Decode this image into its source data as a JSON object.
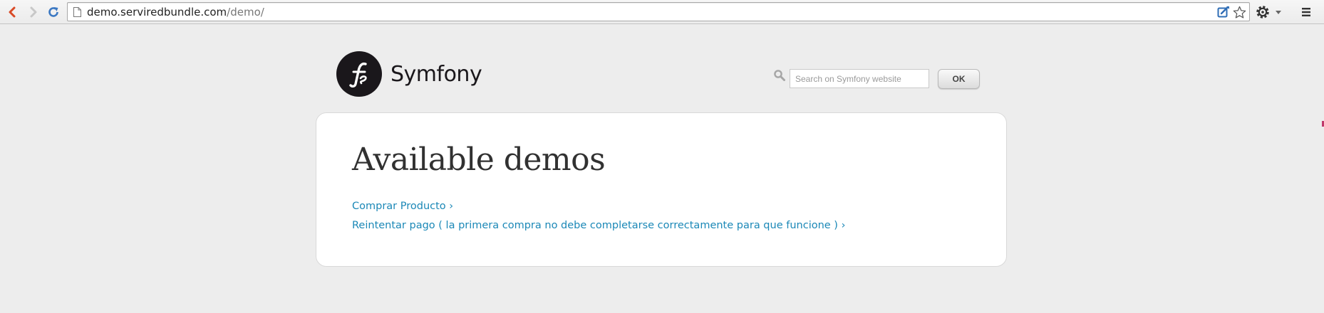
{
  "browser": {
    "url_host": "demo.serviredbundle.com",
    "url_path": "/demo/",
    "icons": [
      "back-arrow-icon",
      "forward-arrow-icon",
      "reload-icon",
      "page-icon",
      "extension-icon",
      "bookmark-star-icon",
      "gear-icon",
      "dropdown-arrow-icon",
      "menu-icon"
    ],
    "accent_color": "#d94a26"
  },
  "header": {
    "logo_text": "Symfony",
    "search_placeholder": "Search on Symfony website",
    "ok_label": "OK"
  },
  "main": {
    "title": "Available demos",
    "demos": [
      {
        "label": "Comprar Producto ›"
      },
      {
        "label": "Reintentar pago ( la primera compra no debe completarse correctamente para que funcione ) ›"
      }
    ],
    "link_color": "#1b88b7"
  }
}
